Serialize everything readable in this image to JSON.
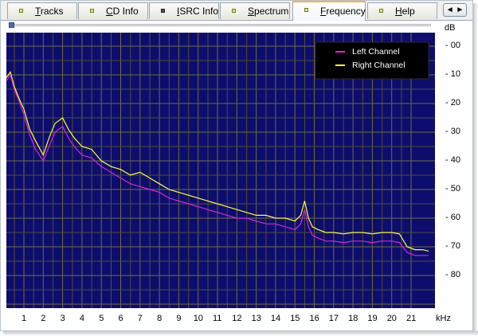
{
  "tabs": [
    {
      "label": "Tracks",
      "u": "T",
      "rest": "racks",
      "led": "green",
      "active": false
    },
    {
      "label": "CD Info",
      "u": "C",
      "rest": "D Info",
      "led": "green",
      "active": false
    },
    {
      "label": "ISRC Info",
      "u": "I",
      "rest": "SRC Info",
      "led": "dark",
      "active": false
    },
    {
      "label": "Spectrum",
      "u": "S",
      "rest": "pectrum",
      "led": "green",
      "active": false
    },
    {
      "label": "Frequency",
      "u": "F",
      "rest": "requency",
      "led": "green",
      "active": true
    },
    {
      "label": "Help",
      "u": "H",
      "rest": "elp",
      "led": "green",
      "active": false
    }
  ],
  "scroll_button": "◄ ►",
  "chart_data": {
    "type": "line",
    "ylabel": "dB",
    "xlabel": "kHz",
    "xlim": [
      0,
      21.9
    ],
    "ylim": [
      0,
      90
    ],
    "y_inverted": true,
    "y_ticks": [
      "00",
      "10",
      "20",
      "30",
      "40",
      "50",
      "60",
      "70",
      "80"
    ],
    "x_ticks": [
      "1",
      "2",
      "3",
      "4",
      "5",
      "6",
      "7",
      "8",
      "9",
      "10",
      "11",
      "12",
      "13",
      "14",
      "15",
      "16",
      "17",
      "18",
      "19",
      "20",
      "21"
    ],
    "grid": true,
    "legend_position": "top-right",
    "series": [
      {
        "name": "Left Channel",
        "color": "#dd22dd",
        "x": [
          0.1,
          0.3,
          0.5,
          0.8,
          1.0,
          1.3,
          1.6,
          2.0,
          2.3,
          2.6,
          3.0,
          3.3,
          3.6,
          4.0,
          4.5,
          5.0,
          5.5,
          6.0,
          6.5,
          7.0,
          7.5,
          8.0,
          8.5,
          9.0,
          9.5,
          10.0,
          10.5,
          11.0,
          11.5,
          12.0,
          12.5,
          13.0,
          13.5,
          14.0,
          14.5,
          15.0,
          15.3,
          15.5,
          15.7,
          15.9,
          16.2,
          16.6,
          17.0,
          17.5,
          18.0,
          18.5,
          19.0,
          19.5,
          20.0,
          20.4,
          20.8,
          21.2,
          21.6,
          21.9
        ],
        "y": [
          12,
          10,
          15,
          20,
          24,
          31,
          36,
          40,
          35,
          30,
          28,
          32,
          35,
          38,
          39,
          42,
          44,
          46,
          48,
          49,
          50,
          51,
          53,
          54,
          55,
          56,
          57,
          58,
          59,
          60,
          60,
          61,
          62,
          62,
          63,
          64,
          62,
          57,
          63,
          66,
          67,
          68,
          68,
          68.5,
          68,
          68,
          68.5,
          68,
          68,
          68.5,
          72,
          73,
          73,
          73
        ]
      },
      {
        "name": "Right Channel",
        "color": "#ffff33",
        "x": [
          0.1,
          0.3,
          0.5,
          0.8,
          1.0,
          1.3,
          1.6,
          2.0,
          2.3,
          2.6,
          3.0,
          3.3,
          3.6,
          4.0,
          4.5,
          5.0,
          5.5,
          6.0,
          6.5,
          7.0,
          7.5,
          8.0,
          8.5,
          9.0,
          9.5,
          10.0,
          10.5,
          11.0,
          11.5,
          12.0,
          12.5,
          13.0,
          13.5,
          14.0,
          14.5,
          15.0,
          15.3,
          15.5,
          15.7,
          15.9,
          16.2,
          16.6,
          17.0,
          17.5,
          18.0,
          18.5,
          19.0,
          19.5,
          20.0,
          20.4,
          20.8,
          21.2,
          21.6,
          21.9
        ],
        "y": [
          11,
          9,
          14,
          19,
          22,
          29,
          33,
          38,
          32,
          27,
          25,
          29,
          32,
          35,
          36,
          40,
          42,
          43,
          45,
          44,
          46,
          48,
          50,
          51,
          52,
          53,
          54,
          55,
          56,
          57,
          58,
          59,
          59,
          60,
          60,
          61,
          59,
          54,
          60,
          63,
          64,
          65,
          65,
          65.5,
          65,
          65,
          65.5,
          65,
          65,
          65.5,
          70,
          71,
          71,
          71.5
        ]
      }
    ]
  }
}
